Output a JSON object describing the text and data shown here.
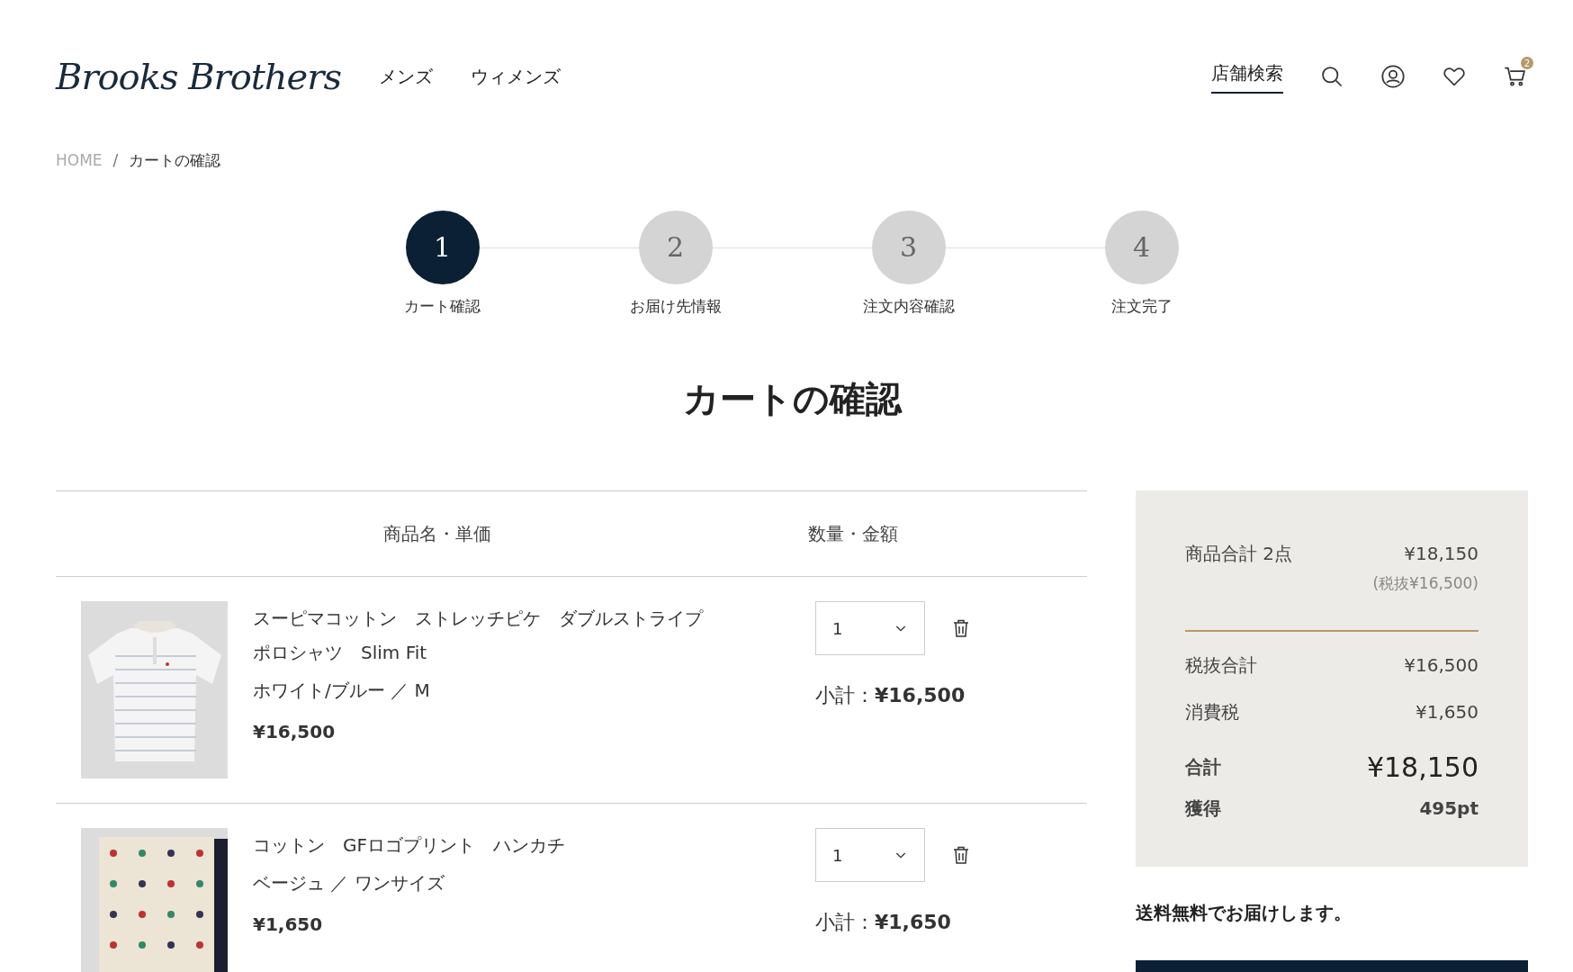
{
  "header": {
    "logo": "Brooks Brothers",
    "nav": [
      "メンズ",
      "ウィメンズ"
    ],
    "store_search": "店舗検索",
    "cart_count": "2"
  },
  "breadcrumb": {
    "items": [
      "HOME",
      "カートの確認"
    ],
    "separator": "/"
  },
  "steps": [
    {
      "number": "1",
      "label": "カート確認",
      "selected": true
    },
    {
      "number": "2",
      "label": "お届け先情報",
      "selected": false
    },
    {
      "number": "3",
      "label": "注文内容確認",
      "selected": false
    },
    {
      "number": "4",
      "label": "注文完了",
      "selected": false
    }
  ],
  "title": "カートの確認",
  "table": {
    "columns": [
      "商品名・単価",
      "数量・金額"
    ],
    "rows": [
      {
        "name_lines": [
          "スーピマコットン　ストレッチピケ　ダブルストライプ",
          "ポロシャツ　Slim Fit"
        ],
        "variant": "ホワイト/ブルー ／ M",
        "price": "¥16,500",
        "quantity": "1",
        "subtotal_label": "小計：",
        "subtotal": "¥16,500"
      },
      {
        "name_lines": [
          "コットン　GFロゴプリント　ハンカチ"
        ],
        "variant": "ベージュ ／ ワンサイズ",
        "price": "¥1,650",
        "quantity": "1",
        "subtotal_label": "小計：",
        "subtotal": "¥1,650"
      }
    ]
  },
  "summary": {
    "items_label": "商品合計 2点",
    "items_total": "¥18,150",
    "items_note": "(税抜¥16,500)",
    "rows": [
      {
        "kind": "normal",
        "label": "税抜合計",
        "value": "¥16,500"
      },
      {
        "kind": "normal",
        "label": "消費税",
        "value": "¥1,650"
      },
      {
        "kind": "total",
        "label": "合計",
        "value": "¥18,150"
      },
      {
        "kind": "points",
        "label": "獲得",
        "value": "495pt"
      }
    ]
  },
  "shipping_note": "送料無料でお届けします。"
}
